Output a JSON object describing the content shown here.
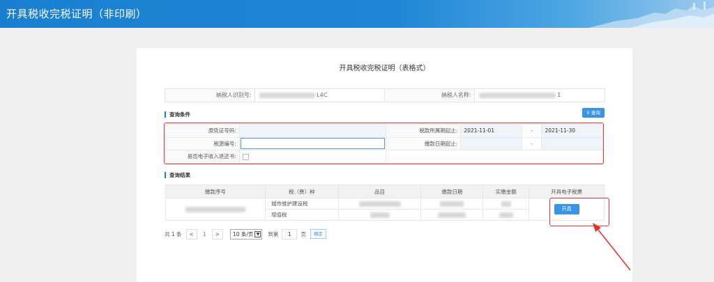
{
  "header": {
    "title": "开具税收完税证明（非印刷）"
  },
  "form": {
    "heading": "开具税收完税证明（表格式）",
    "taxpayer_id_label": "纳税人识别号:",
    "taxpayer_id_value": "L4C",
    "taxpayer_name_label": "纳税人名称:",
    "taxpayer_name_value": "1"
  },
  "conditions": {
    "section_title": "查询条件",
    "search_button": "查询",
    "original_voucher_label": "原凭证号码:",
    "tax_period_label": "税款所属期起止:",
    "tax_period_start": "2021-11-01",
    "tax_period_end": "2021-11-30",
    "tax_source_label": "税源编号:",
    "payment_date_label": "缴款日期起止:",
    "e_refund_label": "是否电子收入退还书:",
    "range_separator": "-"
  },
  "results": {
    "section_title": "查询结果",
    "columns": [
      "缴款序号",
      "税（费）种",
      "品目",
      "缴款日期",
      "实缴金额",
      "开具电子税票"
    ],
    "rows": [
      {
        "tax_type": "城市维护建设税"
      },
      {
        "tax_type": "增值税"
      }
    ],
    "issue_button": "开具"
  },
  "pager": {
    "total": "共 1 条",
    "prev": "<",
    "current": "1",
    "next": ">",
    "page_size": "10 条/页",
    "goto_label": "到第",
    "goto_value": "1",
    "page_unit": "页",
    "confirm": "确定"
  },
  "colors": {
    "header_blue": "#1a7fd0",
    "button_blue": "#3a94e6",
    "highlight_red": "#e0342f"
  }
}
